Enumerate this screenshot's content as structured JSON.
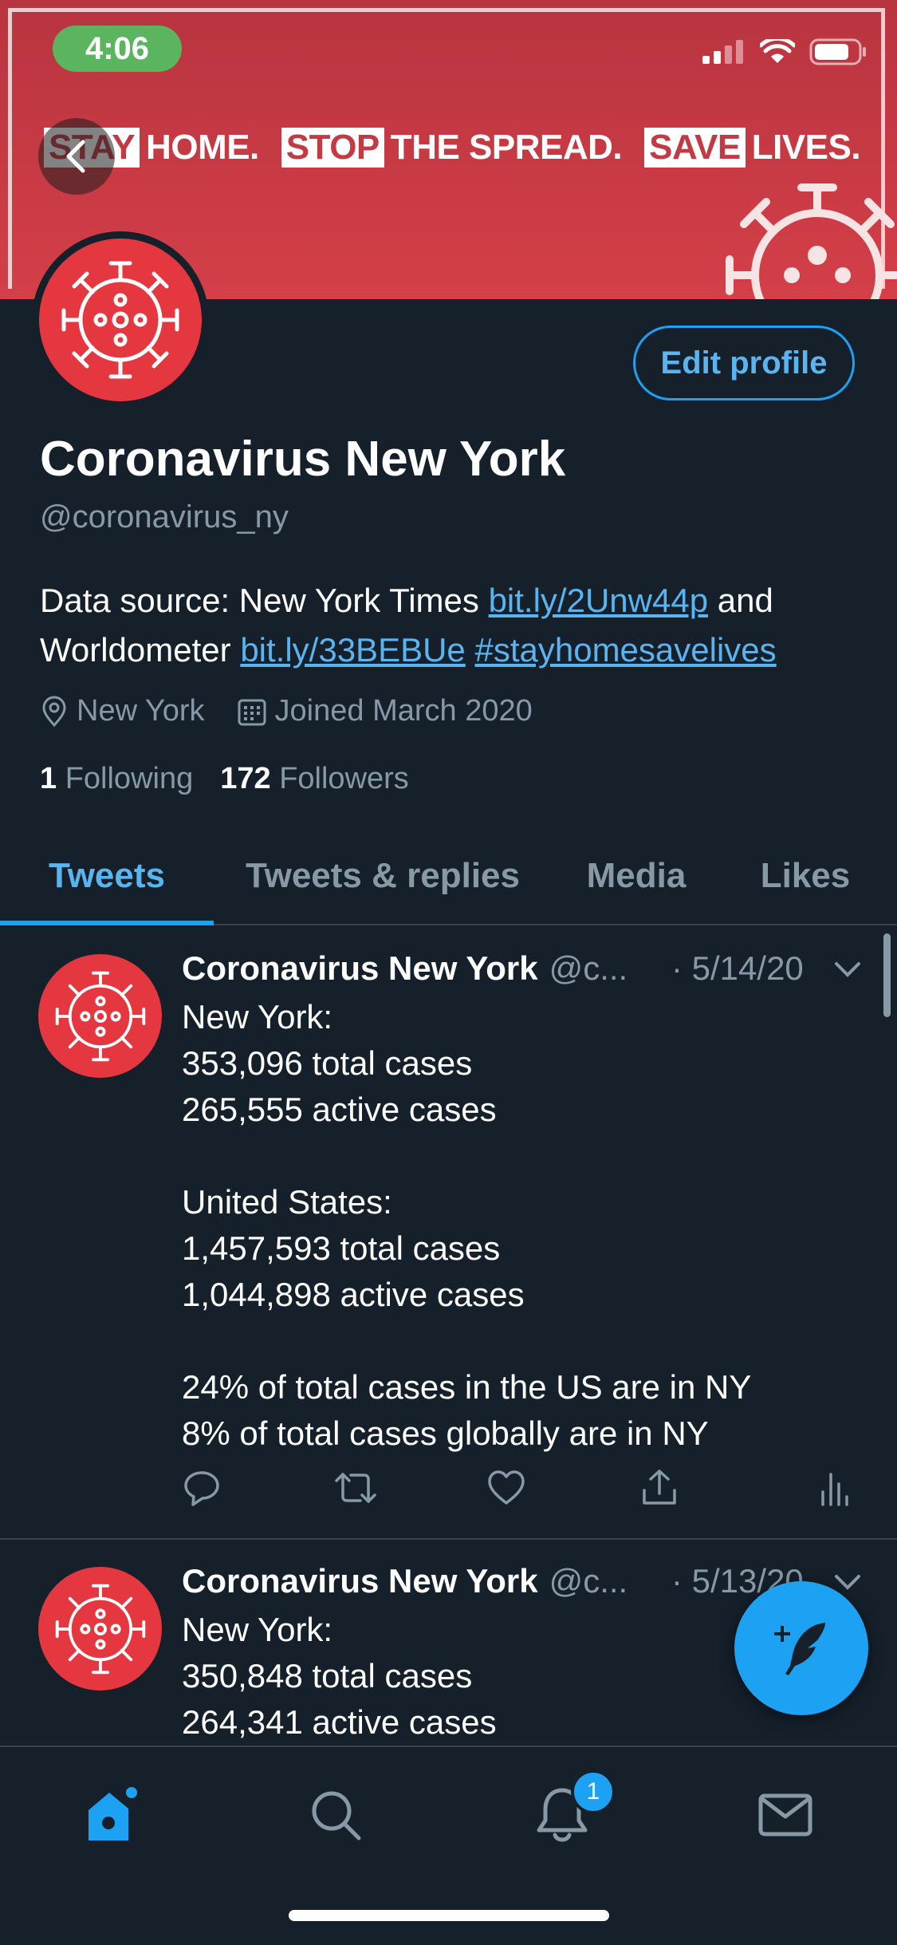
{
  "status_bar": {
    "time": "4:06"
  },
  "banner": {
    "slogan": [
      {
        "boxed": "STAY",
        "rest": "HOME."
      },
      {
        "boxed": "STOP",
        "rest": "THE SPREAD."
      },
      {
        "boxed": "SAVE",
        "rest": "LIVES."
      }
    ],
    "color": "#d43f48"
  },
  "profile": {
    "name": "Coronavirus New York",
    "handle": "@coronavirus_ny",
    "edit_label": "Edit profile",
    "bio_text_1": "Data source: New York Times ",
    "bio_link_1": "bit.ly/2Unw44p",
    "bio_text_2": " and Worldometer ",
    "bio_link_2": "bit.ly/33BEBUe",
    "bio_hashtag": "#stayhomesavelives",
    "location": "New York",
    "joined": "Joined March 2020",
    "following_count": "1",
    "following_label": "Following",
    "followers_count": "172",
    "followers_label": "Followers"
  },
  "tabs": [
    {
      "label": "Tweets",
      "active": true
    },
    {
      "label": "Tweets & replies",
      "active": false
    },
    {
      "label": "Media",
      "active": false
    },
    {
      "label": "Likes",
      "active": false
    }
  ],
  "tweets": [
    {
      "name": "Coronavirus New York",
      "handle": "@c...",
      "date": "· 5/14/20",
      "lines": [
        "New York:",
        "353,096 total cases",
        "265,555 active cases",
        "",
        "United States:",
        "1,457,593 total cases",
        "1,044,898 active cases",
        "",
        "24% of total cases in the US are in NY",
        "8% of total cases globally are in NY"
      ]
    },
    {
      "name": "Coronavirus New York",
      "handle": "@c...",
      "date": "· 5/13/20",
      "lines": [
        "New York:",
        "350,848 total cases",
        "264,341 active cases"
      ]
    }
  ],
  "nav": {
    "notifications_badge": "1"
  },
  "colors": {
    "background": "#15202b",
    "accent": "#1da1f2",
    "secondary_text": "#8899a6"
  }
}
